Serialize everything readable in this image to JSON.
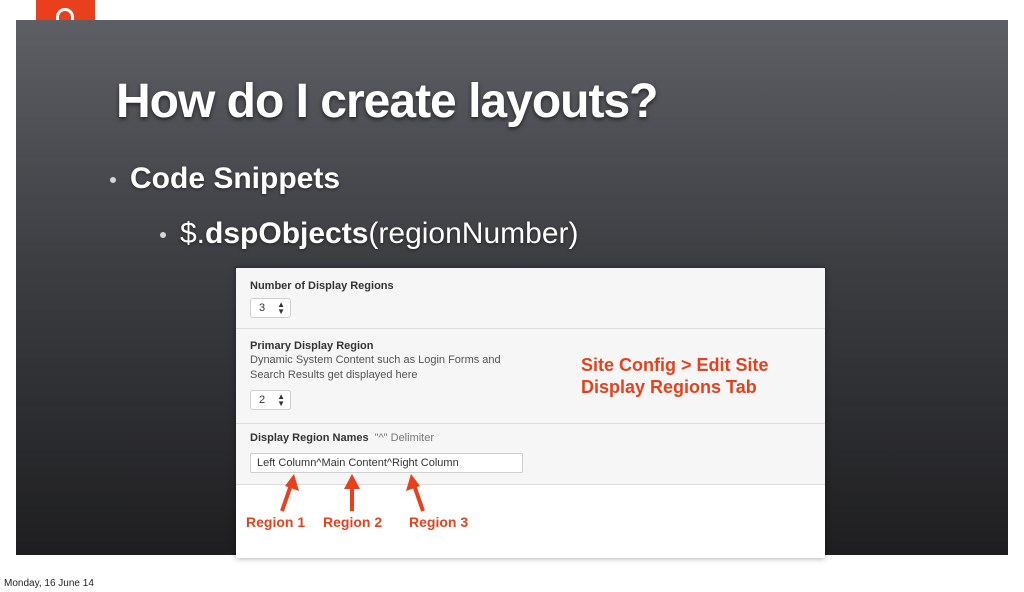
{
  "logo": {
    "text": "mura",
    "color": "#e8401c"
  },
  "slide": {
    "title": "How do I create layouts?",
    "bullet1": "Code Snippets",
    "bullet2": {
      "prefix": "$.",
      "method": "dspObjects",
      "args": "(regionNumber)"
    }
  },
  "panel": {
    "num_regions": {
      "label": "Number of Display Regions",
      "value": "3",
      "chevron": "up-down-chevron-icon"
    },
    "primary_region": {
      "label": "Primary Display Region",
      "description": "Dynamic System Content such as Login Forms and Search Results get displayed here",
      "value": "2"
    },
    "region_names": {
      "label": "Display Region Names",
      "hint": "\"^\" Delimiter",
      "value": "Left Column^Main Content^Right Column"
    },
    "callout": {
      "line1": "Site Config > Edit Site",
      "line2": "Display Regions Tab"
    },
    "region_labels": [
      "Region 1",
      "Region 2",
      "Region 3"
    ],
    "accent": "#e8401c"
  },
  "footer": {
    "date": "Monday, 16 June 14"
  }
}
